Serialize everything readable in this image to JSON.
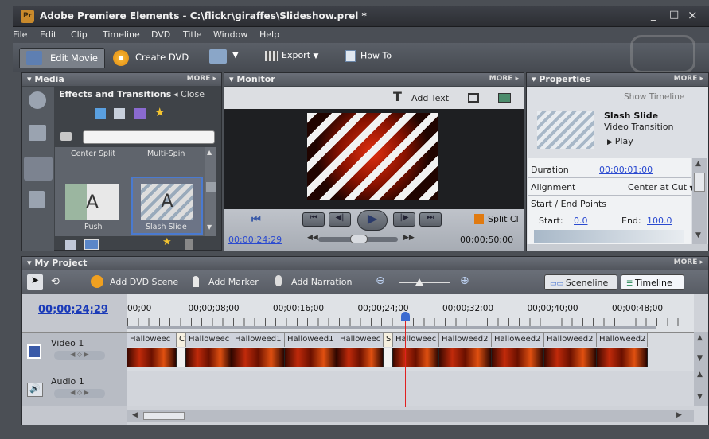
{
  "window": {
    "title": "Adobe Premiere Elements - C:\\flickr\\giraffes\\Slideshow.prel *",
    "controls": [
      "_",
      "□",
      "×"
    ]
  },
  "menu": [
    "File",
    "Edit",
    "Clip",
    "Timeline",
    "DVD",
    "Title",
    "Window",
    "Help"
  ],
  "toolbar": {
    "edit_movie": "Edit Movie",
    "create_dvd": "Create DVD",
    "export": "Export",
    "how_to": "How To"
  },
  "media": {
    "header": "Media",
    "more": "MORE ▸",
    "subtitle": "Effects and Transitions",
    "close": "◂ Close",
    "search_placeholder": "",
    "items_top": [
      "Center Split",
      "Multi-Spin"
    ],
    "items_bottom": [
      "Push",
      "Slash Slide"
    ]
  },
  "monitor": {
    "header": "Monitor",
    "more": "MORE ▸",
    "add_text": "Add Text",
    "split_clip": "Split Cl",
    "current_time": "00;00;24;29",
    "duration": "00;00;50;00"
  },
  "properties": {
    "header": "Properties",
    "more": "MORE ▸",
    "show_timeline": "Show Timeline",
    "name": "Slash Slide",
    "type": "Video Transition",
    "play": "Play",
    "duration_label": "Duration",
    "duration_value": "00;00;01;00",
    "alignment_label": "Alignment",
    "alignment_value": "Center at Cut",
    "start_end_label": "Start / End Points",
    "start_label": "Start:",
    "start_value": "0.0",
    "end_label": "End:",
    "end_value": "100.0"
  },
  "project": {
    "header": "My Project",
    "more": "MORE ▸",
    "add_dvd_scene": "Add DVD Scene",
    "add_marker": "Add Marker",
    "add_narration": "Add Narration",
    "sceneline": "Sceneline",
    "timeline": "Timeline",
    "current_time": "00;00;24;29",
    "ruler": [
      "00;00",
      "00;00;08;00",
      "00;00;16;00",
      "00;00;24;00",
      "00;00;32;00",
      "00;00;40;00",
      "00;00;48;00"
    ],
    "video_track": "Video 1",
    "audio_track": "Audio 1",
    "clips": [
      "Halloweec",
      "C",
      "Halloweec",
      "Halloweed1",
      "Halloweed1",
      "Halloweec",
      "S",
      "Halloweec",
      "Halloweed2",
      "Halloweed2",
      "Halloweed2",
      "Halloweed2"
    ],
    "playhead_fraction": 0.49
  }
}
